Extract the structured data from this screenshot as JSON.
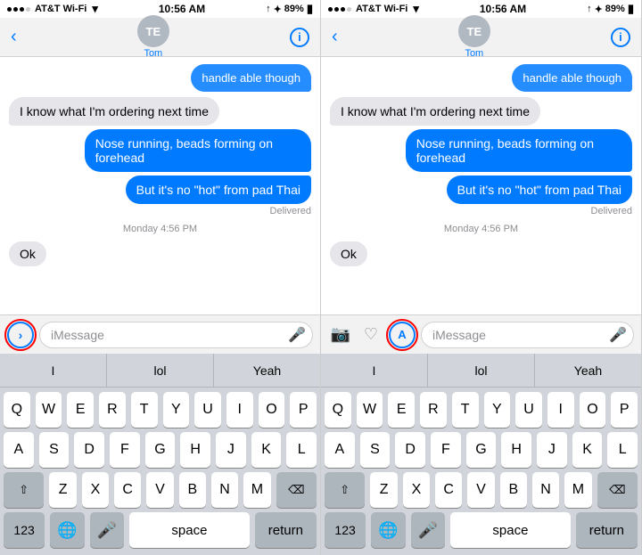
{
  "panels": [
    {
      "id": "left",
      "status": {
        "carrier": "AT&T Wi-Fi",
        "time": "10:56 AM",
        "battery": "89%"
      },
      "nav": {
        "back": "‹",
        "avatar": "TE",
        "name": "Tom",
        "info": "i"
      },
      "messages": [
        {
          "type": "partial-blue",
          "text": "handle able though"
        },
        {
          "type": "left",
          "text": "I know what I'm ordering next time"
        },
        {
          "type": "right",
          "text": "Nose running, beads forming on forehead"
        },
        {
          "type": "right-bottom",
          "text": "But it's no \"hot\" from pad Thai"
        },
        {
          "type": "delivered",
          "text": "Delivered"
        },
        {
          "type": "timestamp",
          "text": "Monday 4:56 PM"
        },
        {
          "type": "left-small",
          "text": "Ok"
        }
      ],
      "input": {
        "expand_label": "›",
        "placeholder": "iMessage",
        "mic": "🎤",
        "highlighted": true
      },
      "autocomplete": [
        "I",
        "lol",
        "Yeah"
      ],
      "keyboard_rows": [
        [
          "Q",
          "W",
          "E",
          "R",
          "T",
          "Y",
          "U",
          "I",
          "O",
          "P"
        ],
        [
          "A",
          "S",
          "D",
          "F",
          "G",
          "H",
          "J",
          "K",
          "L"
        ],
        [
          "⇧",
          "Z",
          "X",
          "C",
          "V",
          "B",
          "N",
          "M",
          "⌫"
        ],
        [
          "123",
          "🌐",
          "🎤",
          "space",
          "return"
        ]
      ]
    },
    {
      "id": "right",
      "status": {
        "carrier": "AT&T Wi-Fi",
        "time": "10:56 AM",
        "battery": "89%"
      },
      "nav": {
        "back": "‹",
        "avatar": "TE",
        "name": "Tom",
        "info": "i"
      },
      "messages": [
        {
          "type": "partial-blue",
          "text": "handle able though"
        },
        {
          "type": "left",
          "text": "I know what I'm ordering next time"
        },
        {
          "type": "right",
          "text": "Nose running, beads forming on forehead"
        },
        {
          "type": "right-bottom",
          "text": "But it's no \"hot\" from pad Thai"
        },
        {
          "type": "delivered",
          "text": "Delivered"
        },
        {
          "type": "timestamp",
          "text": "Monday 4:56 PM"
        },
        {
          "type": "left-small",
          "text": "Ok"
        }
      ],
      "input": {
        "camera": "📷",
        "heart": "♡",
        "expand_label": "A",
        "placeholder": "iMessage",
        "mic": "🎤",
        "highlighted": true
      },
      "autocomplete": [
        "I",
        "lol",
        "Yeah"
      ],
      "keyboard_rows": [
        [
          "Q",
          "W",
          "E",
          "R",
          "T",
          "Y",
          "U",
          "I",
          "O",
          "P"
        ],
        [
          "A",
          "S",
          "D",
          "F",
          "G",
          "H",
          "J",
          "K",
          "L"
        ],
        [
          "⇧",
          "Z",
          "X",
          "C",
          "V",
          "B",
          "N",
          "M",
          "⌫"
        ],
        [
          "123",
          "🌐",
          "🎤",
          "space",
          "return"
        ]
      ]
    }
  ]
}
